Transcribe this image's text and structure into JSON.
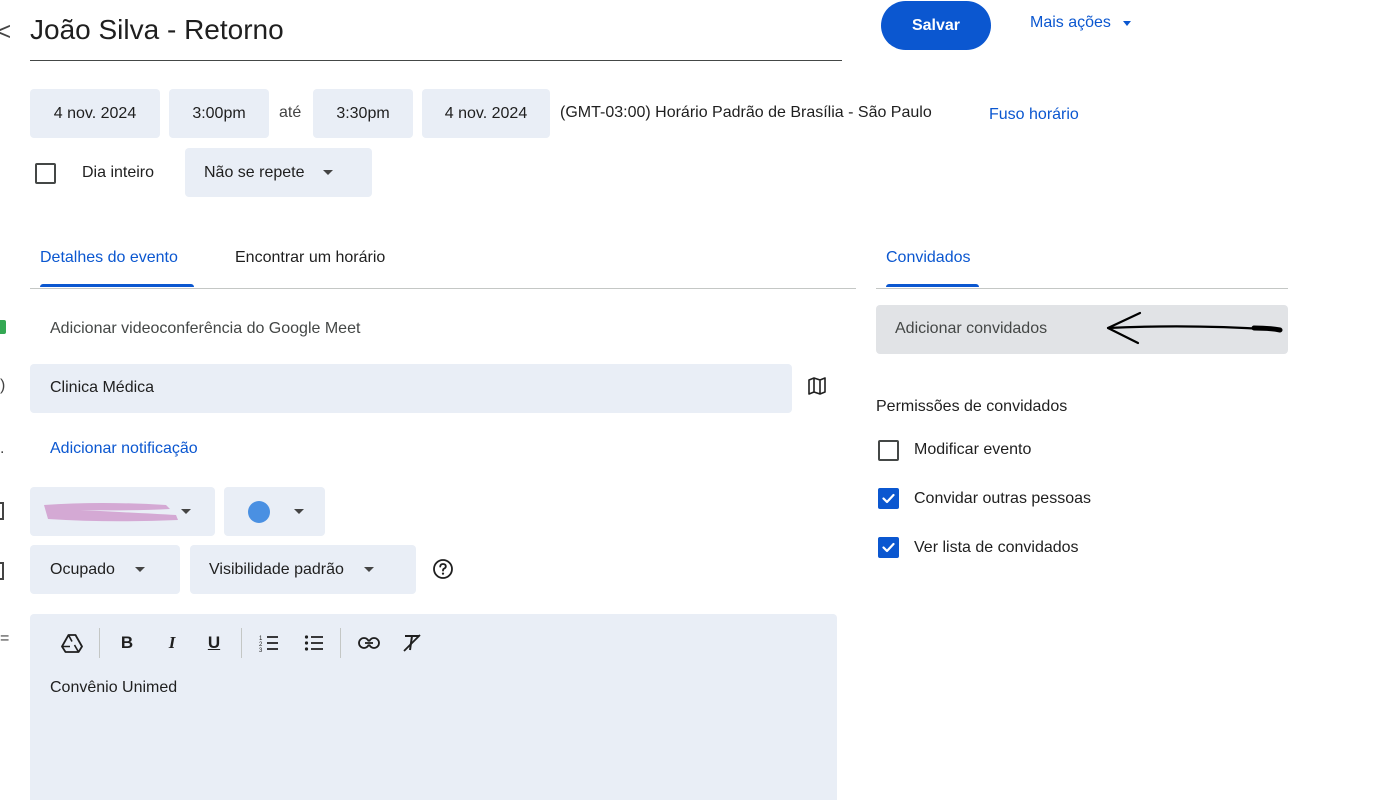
{
  "header": {
    "back_glyph": "<",
    "title": "João Silva - Retorno",
    "save_label": "Salvar",
    "more_actions_label": "Mais ações"
  },
  "datetime": {
    "start_date": "4 nov. 2024",
    "start_time": "3:00pm",
    "until_label": "até",
    "end_time": "3:30pm",
    "end_date": "4 nov. 2024",
    "timezone_text": "(GMT-03:00) Horário Padrão de Brasília - São Paulo",
    "timezone_link": "Fuso horário",
    "all_day_label": "Dia inteiro",
    "all_day_checked": false,
    "repeat_label": "Não se repete"
  },
  "tabs": [
    {
      "label": "Detalhes do evento",
      "active": true
    },
    {
      "label": "Encontrar um horário",
      "active": false
    }
  ],
  "details": {
    "meet_label": "Adicionar videoconferência do Google Meet",
    "location_value": "Clinica Médica",
    "add_notification_label": "Adicionar notificação",
    "status_label": "Ocupado",
    "visibility_label": "Visibilidade padrão",
    "event_color": "#4a90e2",
    "description": "Convênio Unimed"
  },
  "toolbar": {
    "icons": [
      "drive-icon",
      "bold-icon",
      "italic-icon",
      "underline-icon",
      "numbered-list-icon",
      "bulleted-list-icon",
      "link-icon",
      "remove-format-icon"
    ],
    "bold_glyph": "B",
    "italic_glyph": "I",
    "underline_glyph": "U"
  },
  "guests": {
    "tab_label": "Convidados",
    "add_guests_placeholder": "Adicionar convidados",
    "permissions_title": "Permissões de convidados",
    "permissions": [
      {
        "label": "Modificar evento",
        "checked": false
      },
      {
        "label": "Convidar outras pessoas",
        "checked": true
      },
      {
        "label": "Ver lista de convidados",
        "checked": true
      }
    ]
  },
  "colors": {
    "accent": "#0b57d0",
    "chip_bg": "#e9eef6",
    "field_bg": "#e1e3e6",
    "redaction": "#d4a9d4"
  }
}
